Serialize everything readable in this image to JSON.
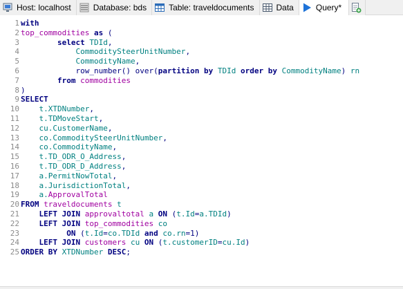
{
  "tabs": [
    {
      "label": "Host: localhost",
      "icon": "host-icon",
      "active": false
    },
    {
      "label": "Database: bds",
      "icon": "database-icon",
      "active": false
    },
    {
      "label": "Table: traveldocuments",
      "icon": "table-icon",
      "active": false
    },
    {
      "label": "Data",
      "icon": "data-grid-icon",
      "active": false
    },
    {
      "label": "Query*",
      "icon": "query-play-icon",
      "active": true
    }
  ],
  "new_tab_icon": "new-query-tab-icon",
  "colors": {
    "keyword": "#000080",
    "identifier": "#008080",
    "table": "#a000a0",
    "line_number": "#8a8a8a",
    "play_icon": "#1e73d8"
  },
  "editor": {
    "lines": [
      {
        "n": "1",
        "tokens": [
          [
            "kw",
            "with"
          ]
        ]
      },
      {
        "n": "2",
        "tokens": [
          [
            "tb",
            "top_commodities"
          ],
          [
            "pl",
            " "
          ],
          [
            "kw",
            "as"
          ],
          [
            "pl",
            " ("
          ]
        ]
      },
      {
        "n": "3",
        "tokens": [
          [
            "pl",
            "        "
          ],
          [
            "kw",
            "select"
          ],
          [
            "pl",
            " "
          ],
          [
            "id",
            "TDId"
          ],
          [
            "pl",
            ","
          ]
        ]
      },
      {
        "n": "4",
        "tokens": [
          [
            "pl",
            "            "
          ],
          [
            "id",
            "CommoditySteerUnitNumber"
          ],
          [
            "pl",
            ","
          ]
        ]
      },
      {
        "n": "5",
        "tokens": [
          [
            "pl",
            "            "
          ],
          [
            "id",
            "CommodityName"
          ],
          [
            "pl",
            ","
          ]
        ]
      },
      {
        "n": "6",
        "tokens": [
          [
            "pl",
            "            "
          ],
          [
            "fn",
            "row_number"
          ],
          [
            "pl",
            "() "
          ],
          [
            "fn",
            "over"
          ],
          [
            "pl",
            "("
          ],
          [
            "kw",
            "partition"
          ],
          [
            "pl",
            " "
          ],
          [
            "kw",
            "by"
          ],
          [
            "pl",
            " "
          ],
          [
            "id",
            "TDId"
          ],
          [
            "pl",
            " "
          ],
          [
            "kw",
            "order"
          ],
          [
            "pl",
            " "
          ],
          [
            "kw",
            "by"
          ],
          [
            "pl",
            " "
          ],
          [
            "id",
            "CommodityName"
          ],
          [
            "pl",
            ") "
          ],
          [
            "id",
            "rn"
          ]
        ]
      },
      {
        "n": "7",
        "tokens": [
          [
            "pl",
            "        "
          ],
          [
            "kw",
            "from"
          ],
          [
            "pl",
            " "
          ],
          [
            "tb",
            "commodities"
          ]
        ]
      },
      {
        "n": "8",
        "tokens": [
          [
            "pl",
            ")"
          ]
        ]
      },
      {
        "n": "9",
        "tokens": [
          [
            "kw",
            "SELECT"
          ]
        ]
      },
      {
        "n": "10",
        "tokens": [
          [
            "pl",
            "    "
          ],
          [
            "id",
            "t.XTDNumber"
          ],
          [
            "pl",
            ","
          ]
        ]
      },
      {
        "n": "11",
        "tokens": [
          [
            "pl",
            "    "
          ],
          [
            "id",
            "t.TDMoveStart"
          ],
          [
            "pl",
            ","
          ]
        ]
      },
      {
        "n": "12",
        "tokens": [
          [
            "pl",
            "    "
          ],
          [
            "id",
            "cu.CustomerName"
          ],
          [
            "pl",
            ","
          ]
        ]
      },
      {
        "n": "13",
        "tokens": [
          [
            "pl",
            "    "
          ],
          [
            "id",
            "co.CommoditySteerUnitNumber"
          ],
          [
            "pl",
            ","
          ]
        ]
      },
      {
        "n": "14",
        "tokens": [
          [
            "pl",
            "    "
          ],
          [
            "id",
            "co.CommodityName"
          ],
          [
            "pl",
            ","
          ]
        ]
      },
      {
        "n": "15",
        "tokens": [
          [
            "pl",
            "    "
          ],
          [
            "id",
            "t.TD_ODR_O_Address"
          ],
          [
            "pl",
            ","
          ]
        ]
      },
      {
        "n": "16",
        "tokens": [
          [
            "pl",
            "    "
          ],
          [
            "id",
            "t.TD_ODR_D_Address"
          ],
          [
            "pl",
            ","
          ]
        ]
      },
      {
        "n": "17",
        "tokens": [
          [
            "pl",
            "    "
          ],
          [
            "id",
            "a.PermitNowTotal"
          ],
          [
            "pl",
            ","
          ]
        ]
      },
      {
        "n": "18",
        "tokens": [
          [
            "pl",
            "    "
          ],
          [
            "id",
            "a.JurisdictionTotal"
          ],
          [
            "pl",
            ","
          ]
        ]
      },
      {
        "n": "19",
        "tokens": [
          [
            "pl",
            "    "
          ],
          [
            "id",
            "a."
          ],
          [
            "tb",
            "ApprovalTotal"
          ]
        ]
      },
      {
        "n": "20",
        "tokens": [
          [
            "kw",
            "FROM"
          ],
          [
            "pl",
            " "
          ],
          [
            "tb",
            "traveldocuments"
          ],
          [
            "pl",
            " "
          ],
          [
            "id",
            "t"
          ]
        ]
      },
      {
        "n": "21",
        "tokens": [
          [
            "pl",
            "    "
          ],
          [
            "kw",
            "LEFT JOIN"
          ],
          [
            "pl",
            " "
          ],
          [
            "tb",
            "approvaltotal"
          ],
          [
            "pl",
            " "
          ],
          [
            "id",
            "a"
          ],
          [
            "pl",
            " "
          ],
          [
            "kw",
            "ON"
          ],
          [
            "pl",
            " ("
          ],
          [
            "id",
            "t.Id"
          ],
          [
            "pl",
            "="
          ],
          [
            "id",
            "a.TDId"
          ],
          [
            "pl",
            ")"
          ]
        ]
      },
      {
        "n": "22",
        "tokens": [
          [
            "pl",
            "    "
          ],
          [
            "kw",
            "LEFT JOIN"
          ],
          [
            "pl",
            " "
          ],
          [
            "tb",
            "top_commodities"
          ],
          [
            "pl",
            " "
          ],
          [
            "id",
            "co"
          ]
        ]
      },
      {
        "n": "23",
        "tokens": [
          [
            "pl",
            "          "
          ],
          [
            "kw",
            "ON"
          ],
          [
            "pl",
            " ("
          ],
          [
            "id",
            "t.Id"
          ],
          [
            "pl",
            "="
          ],
          [
            "id",
            "co.TDId"
          ],
          [
            "pl",
            " "
          ],
          [
            "kw",
            "and"
          ],
          [
            "pl",
            " "
          ],
          [
            "id",
            "co.rn"
          ],
          [
            "pl",
            "="
          ],
          [
            "nm",
            "1"
          ],
          [
            "pl",
            ")"
          ]
        ]
      },
      {
        "n": "24",
        "tokens": [
          [
            "pl",
            "    "
          ],
          [
            "kw",
            "LEFT JOIN"
          ],
          [
            "pl",
            " "
          ],
          [
            "tb",
            "customers"
          ],
          [
            "pl",
            " "
          ],
          [
            "id",
            "cu"
          ],
          [
            "pl",
            " "
          ],
          [
            "kw",
            "ON"
          ],
          [
            "pl",
            " ("
          ],
          [
            "id",
            "t.customerID"
          ],
          [
            "pl",
            "="
          ],
          [
            "id",
            "cu.Id"
          ],
          [
            "pl",
            ")"
          ]
        ]
      },
      {
        "n": "25",
        "tokens": [
          [
            "kw",
            "ORDER BY"
          ],
          [
            "pl",
            " "
          ],
          [
            "id",
            "XTDNumber"
          ],
          [
            "pl",
            " "
          ],
          [
            "kw",
            "DESC"
          ],
          [
            "pl",
            ";"
          ]
        ]
      }
    ]
  }
}
